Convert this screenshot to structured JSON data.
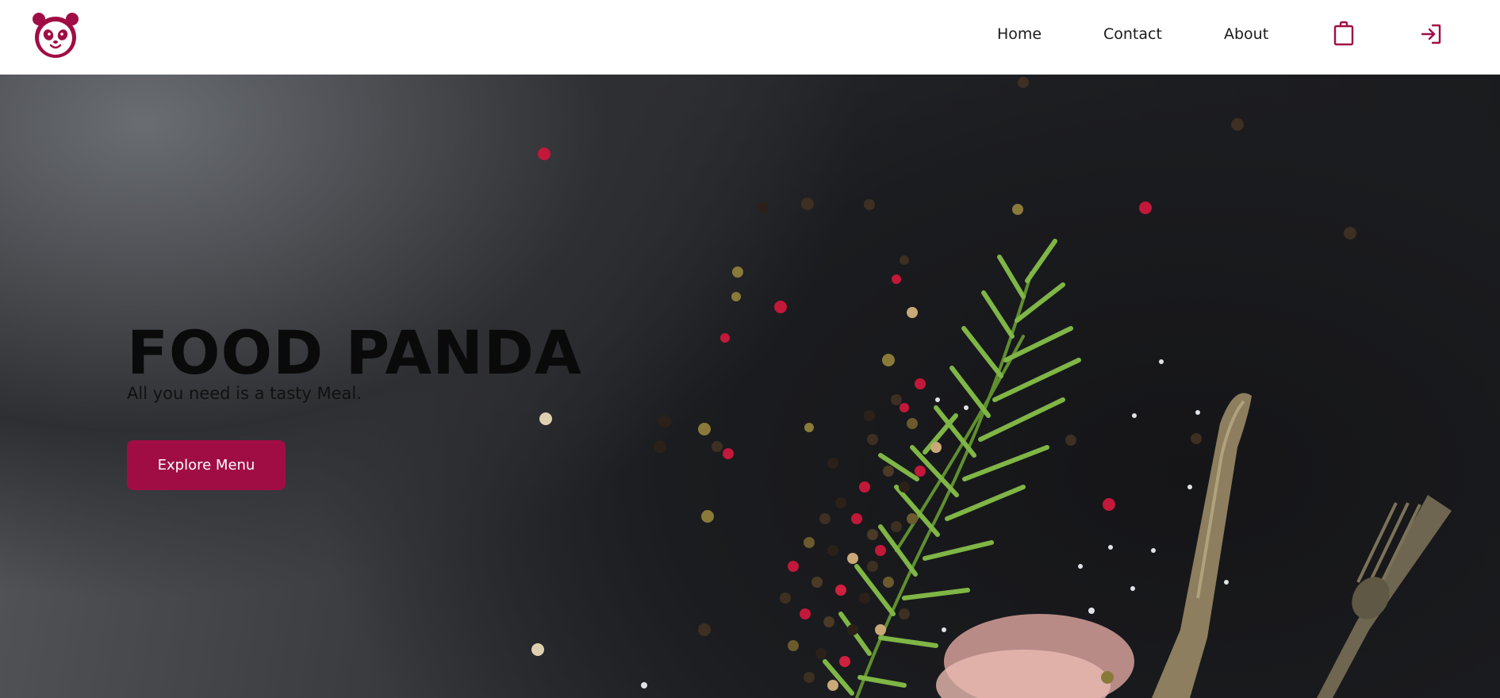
{
  "brand": {
    "logo_icon": "panda-logo-icon",
    "accent_color": "#a00d45"
  },
  "nav": {
    "items": [
      {
        "label": "Home"
      },
      {
        "label": "Contact"
      },
      {
        "label": "About"
      }
    ],
    "bag_icon": "shopping-bag-icon",
    "login_icon": "login-icon"
  },
  "hero": {
    "title": "FOOD PANDA",
    "subtitle": "All you need is a tasty Meal.",
    "button_label": "Explore Menu"
  }
}
